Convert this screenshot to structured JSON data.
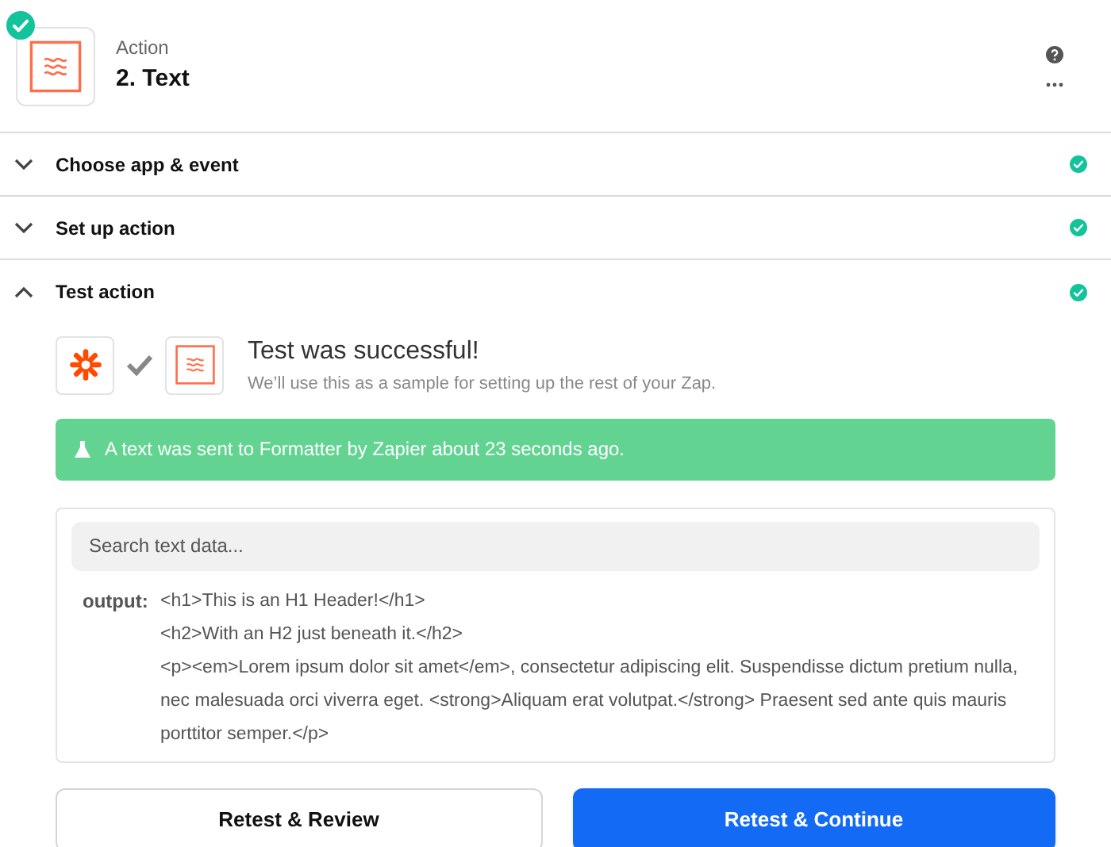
{
  "header": {
    "subtitle": "Action",
    "title": "2. Text",
    "completed": true
  },
  "sections": [
    {
      "label": "Choose app & event",
      "expanded": false,
      "completed": true
    },
    {
      "label": "Set up action",
      "expanded": false,
      "completed": true
    },
    {
      "label": "Test action",
      "expanded": true,
      "completed": true
    }
  ],
  "test": {
    "title": "Test was successful!",
    "description": "We’ll use this as a sample for setting up the rest of your Zap.",
    "banner": "A text was sent to Formatter by Zapier about 23 seconds ago.",
    "search": {
      "placeholder": "Search text data..."
    },
    "output_label": "output:",
    "output_lines": [
      "<h1>This is an H1 Header!</h1>",
      "<h2>With an H2 just beneath it.</h2>",
      "<p><em>Lorem ipsum dolor sit amet</em>, consectetur adipiscing elit. Suspendisse dictum pretium nulla, nec malesuada orci viverra eget. <strong>Aliquam erat volutpat.</strong> Praesent sed ante quis mauris porttitor semper.</p>"
    ]
  },
  "buttons": [
    {
      "label": "Retest & Review",
      "kind": "secondary"
    },
    {
      "label": "Retest & Continue",
      "kind": "primary"
    }
  ]
}
